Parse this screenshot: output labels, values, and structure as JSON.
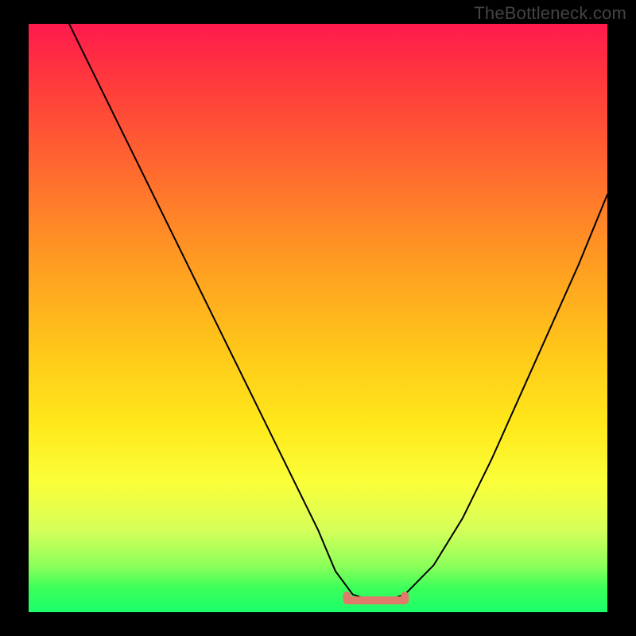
{
  "watermark": "TheBottleneck.com",
  "chart_data": {
    "type": "line",
    "title": "",
    "xlabel": "",
    "ylabel": "",
    "xlim": [
      0,
      100
    ],
    "ylim": [
      0,
      100
    ],
    "grid": false,
    "legend": false,
    "series": [
      {
        "name": "bottleneck-curve",
        "x": [
          7,
          10,
          15,
          20,
          25,
          30,
          35,
          40,
          45,
          50,
          53,
          56,
          59,
          62,
          65,
          70,
          75,
          80,
          85,
          90,
          95,
          100
        ],
        "values": [
          100,
          94,
          84,
          74,
          64,
          54,
          44,
          34,
          24,
          14,
          7,
          3,
          2,
          2,
          3,
          8,
          16,
          26,
          37,
          48,
          59,
          71
        ]
      }
    ],
    "annotations": [
      {
        "name": "flat-minimum-marker",
        "x_range": [
          55,
          65
        ],
        "y": 2
      }
    ],
    "background_gradient": {
      "top": "#ff1a4d",
      "bottom": "#1aff6a"
    }
  }
}
